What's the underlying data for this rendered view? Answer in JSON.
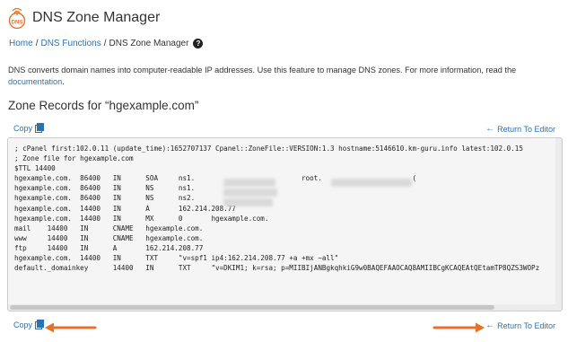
{
  "app": {
    "title": "DNS Zone Manager",
    "icon_label": "DNS",
    "icon_name": "dns-satellite-icon",
    "accent": "#e8702a"
  },
  "breadcrumb": {
    "home": "Home",
    "sep": "/",
    "functions": "DNS Functions",
    "current": "DNS Zone Manager",
    "help_icon": "question-circle-icon"
  },
  "description": {
    "text": "DNS converts domain names into computer-readable IP addresses. Use this feature to manage DNS zones. For more information, read the",
    "link": "documentation",
    "end": "."
  },
  "zone": {
    "title": "Zone Records for “hgexample.com”"
  },
  "actions": {
    "copy": "Copy",
    "return": "Return To Editor",
    "copy_icon": "copy-icon",
    "return_icon": "arrow-left-icon"
  },
  "records": {
    "lines": [
      "; cPanel first:102.0.11 (update_time):1652707137 Cpanel::ZoneFile::VERSION:1.3 hostname:5146610.km-guru.info latest:102.0.15",
      "; Zone file for hgexample.com",
      "$TTL 14400",
      "hgexample.com.  86400   IN      SOA     ns1.                          root.                      (",
      "hgexample.com.  86400   IN      NS      ns1.",
      "hgexample.com.  86400   IN      NS      ns2.",
      "hgexample.com.  14400   IN      A       162.214.208.77",
      "hgexample.com.  14400   IN      MX      0       hgexample.com.",
      "mail    14400   IN      CNAME   hgexample.com.",
      "www     14400   IN      CNAME   hgexample.com.",
      "ftp     14400   IN      A       162.214.208.77",
      "hgexample.com.  14400   IN      TXT     \"v=spf1 ip4:162.214.208.77 +a +mx ~all\"",
      "default._domainkey      14400   IN      TXT     \"v=DKIM1; k=rsa; p=MIIBIjANBgkqhkiG9w0BAQEFAAOCAQ8AMIIBCgKCAQEAtQEtamTP8QZS3WOPz"
    ]
  }
}
